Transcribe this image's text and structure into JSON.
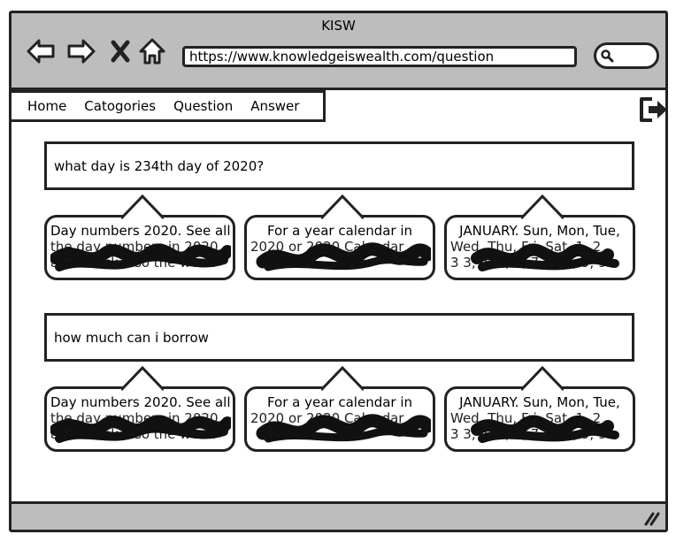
{
  "window": {
    "title": "KISW"
  },
  "toolbar": {
    "back_icon": "back-arrow-icon",
    "forward_icon": "forward-arrow-icon",
    "stop_icon": "close-icon",
    "home_icon": "home-icon",
    "url": "https://www.knowledgeiswealth.com/question",
    "search_icon": "search-icon"
  },
  "menu": {
    "items": [
      {
        "label": "Home"
      },
      {
        "label": "Catogories"
      },
      {
        "label": "Question"
      },
      {
        "label": "Answer"
      }
    ]
  },
  "logout": {
    "icon": "logout-icon"
  },
  "questions": [
    {
      "text": "what day is 234th day of 2020?",
      "answers": [
        {
          "line1": "Day numbers 2020. See all",
          "line2": "the day numbers in 2020",
          "line3": "and check also the week"
        },
        {
          "line1": "For a year calendar in",
          "line2": "2020 or 2020 Calendar",
          "line3": ""
        },
        {
          "line1": "JANUARY. Sun, Mon, Tue,",
          "line2": "Wed, Thu, Fri, Sat, 1, 2",
          "line3": "3 3, 4, 5, 6, 7, 7, 8, 9, 9"
        }
      ]
    },
    {
      "text": "how much can i borrow",
      "answers": [
        {
          "line1": "Day numbers 2020. See all",
          "line2": "the day numbers in 2020",
          "line3": "and check also the week"
        },
        {
          "line1": "For a year calendar in",
          "line2": "2020 or 2020 Calendar",
          "line3": ""
        },
        {
          "line1": "JANUARY. Sun, Mon, Tue,",
          "line2": "Wed, Thu, Fri, Sat, 1, 2",
          "line3": "3 3, 4, 5, 6, 7, 7, 8, 9, 9"
        }
      ]
    }
  ]
}
